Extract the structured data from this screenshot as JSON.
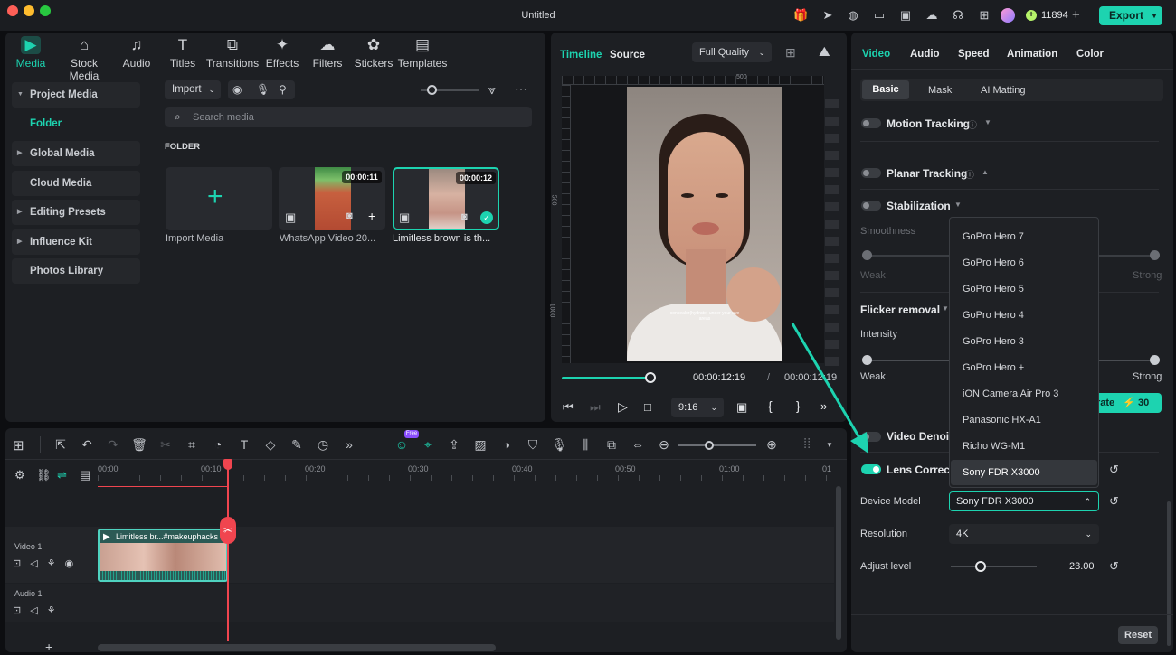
{
  "window": {
    "title": "Untitled",
    "credits": "11894",
    "export_label": "Export"
  },
  "media_tabs": [
    {
      "label": "Media",
      "icon": "media-icon"
    },
    {
      "label": "Stock Media",
      "icon": "stock-media-icon"
    },
    {
      "label": "Audio",
      "icon": "audio-icon"
    },
    {
      "label": "Titles",
      "icon": "titles-icon"
    },
    {
      "label": "Transitions",
      "icon": "transitions-icon"
    },
    {
      "label": "Effects",
      "icon": "effects-icon"
    },
    {
      "label": "Filters",
      "icon": "filters-icon"
    },
    {
      "label": "Stickers",
      "icon": "stickers-icon"
    },
    {
      "label": "Templates",
      "icon": "templates-icon"
    }
  ],
  "sidebar": {
    "items": [
      {
        "label": "Project Media"
      },
      {
        "label": "Folder"
      },
      {
        "label": "Global Media"
      },
      {
        "label": "Cloud Media"
      },
      {
        "label": "Editing Presets"
      },
      {
        "label": "Influence Kit"
      },
      {
        "label": "Photos Library"
      }
    ]
  },
  "media": {
    "import_label": "Import",
    "search_placeholder": "Search media",
    "folder_heading": "FOLDER",
    "items": [
      {
        "label": "Import Media"
      },
      {
        "label": "WhatsApp Video 20...",
        "duration": "00:00:11"
      },
      {
        "label": "Limitless brown is th...",
        "duration": "00:00:12"
      }
    ]
  },
  "preview": {
    "tab_timeline": "Timeline",
    "tab_source": "Source",
    "quality": "Full Quality",
    "ruler_top": "500",
    "ruler_left": [
      "500",
      "1000"
    ],
    "caption": "concealer(hydrate) under your eye areas",
    "time_current": "00:00:12:19",
    "time_sep": "/",
    "time_total": "00:00:12:19",
    "ratio": "9:16",
    "brace_open": "{",
    "brace_close": "}",
    "progress": 0.96
  },
  "right_panel": {
    "tabs": [
      "Video",
      "Audio",
      "Speed",
      "Animation",
      "Color"
    ],
    "subtabs": [
      "Basic",
      "Mask",
      "AI Matting"
    ],
    "motion_tracking": "Motion Tracking",
    "planar_tracking": "Planar Tracking",
    "stabilization": "Stabilization",
    "smoothness": "Smoothness",
    "weak": "Weak",
    "strong": "Strong",
    "flicker_removal": "Flicker removal",
    "intensity": "Intensity",
    "weak2": "Weak",
    "strong2": "Strong",
    "generate": "rate",
    "generate_cost": "30",
    "video_denoise": "Video Denoise",
    "lens_correction": "Lens Correction",
    "device_model_label": "Device Model",
    "device_model_value": "Sony FDR X3000",
    "resolution_label": "Resolution",
    "resolution_value": "4K",
    "adjust_label": "Adjust level",
    "adjust_value": "23.00",
    "adjust_level": 0.35,
    "reset": "Reset",
    "dropdown_options": [
      "GoPro Hero 7",
      "GoPro Hero 6",
      "GoPro Hero 5",
      "GoPro Hero 4",
      "GoPro Hero 3",
      "GoPro Hero +",
      "iON Camera Air Pro 3",
      "Panasonic HX-A1",
      "Richo WG-M1",
      "Sony FDR X3000"
    ]
  },
  "timeline": {
    "ruler": [
      "00:00",
      "00:10",
      "00:20",
      "00:30",
      "00:40",
      "00:50",
      "01:00",
      "01"
    ],
    "video_track": "Video 1",
    "audio_track": "Audio 1",
    "clip_label": "Limitless br...#makeuphacks",
    "free_badge": "Free"
  },
  "colors": {
    "accent": "#1dd3b0",
    "playhead": "#f0454f"
  }
}
